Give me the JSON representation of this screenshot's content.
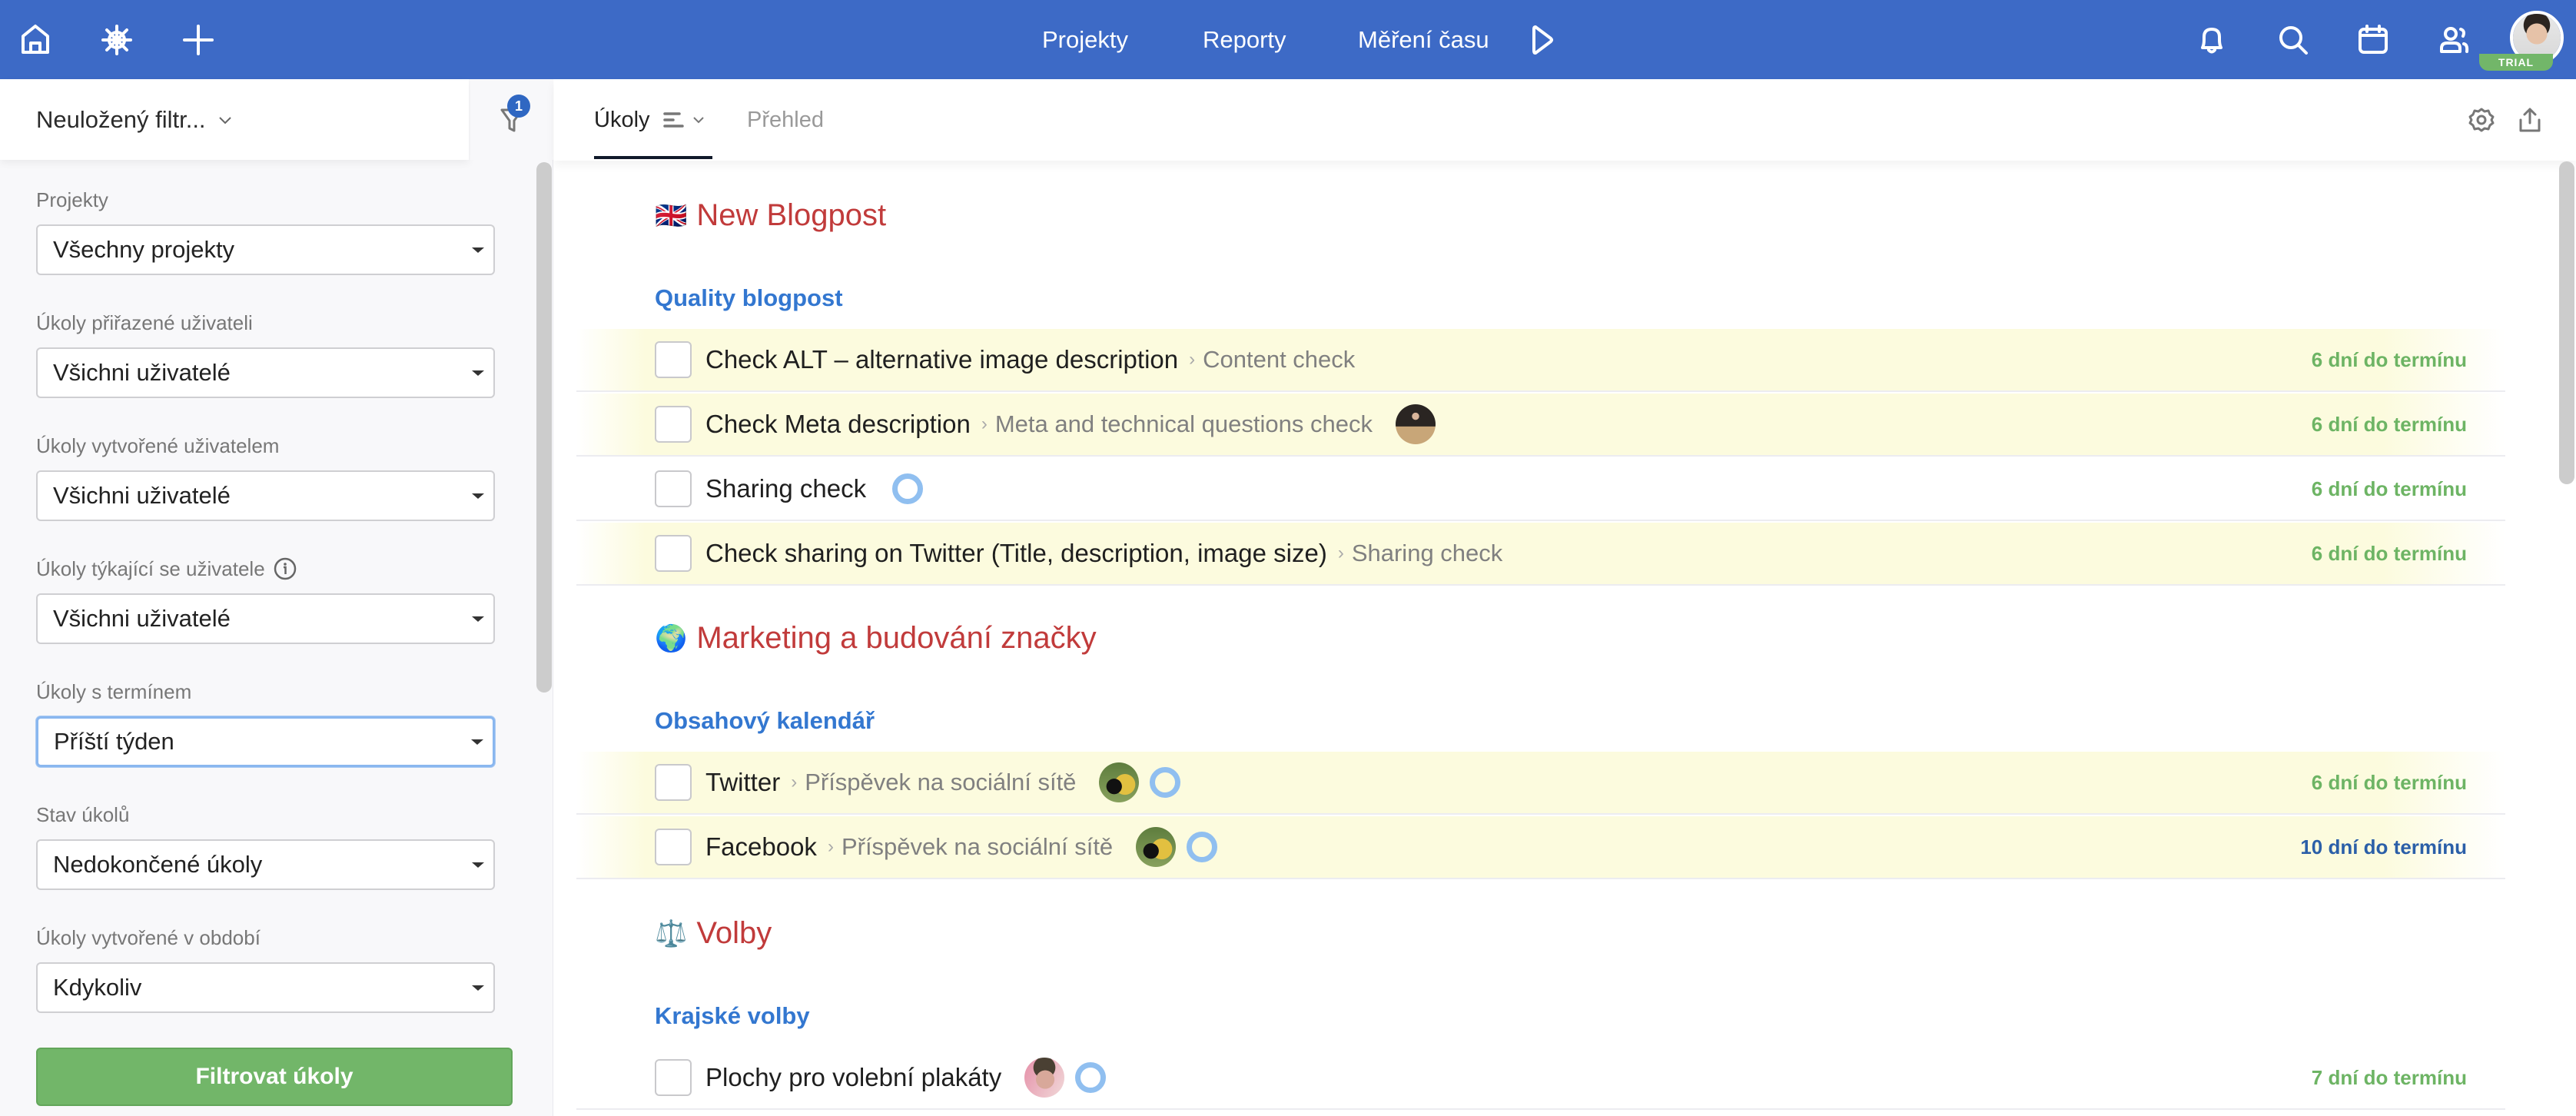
{
  "colors": {
    "topbar": "#3d6ac6",
    "accent_green": "#72b669",
    "project_title": "#c13b3b",
    "section_title": "#3377d0",
    "due_soon": "#6db464",
    "due_later": "#2b5fa8",
    "row_highlight": "#fcfbde"
  },
  "topbar": {
    "left_icons": [
      "home-icon",
      "helm-icon",
      "plus-icon"
    ],
    "nav": [
      {
        "label": "Projekty"
      },
      {
        "label": "Reporty"
      },
      {
        "label": "Měření času"
      }
    ],
    "right_icons": [
      "bell-icon",
      "search-icon",
      "calendar-icon",
      "users-icon"
    ],
    "user_badge": "TRIAL"
  },
  "sidebar": {
    "filter_name": "Neuložený filtr...",
    "filter_count": "1",
    "fields": [
      {
        "label": "Projekty",
        "value": "Všechny projekty"
      },
      {
        "label": "Úkoly přiřazené uživateli",
        "value": "Všichni uživatelé"
      },
      {
        "label": "Úkoly vytvořené uživatelem",
        "value": "Všichni uživatelé"
      },
      {
        "label": "Úkoly týkající se uživatele",
        "value": "Všichni uživatelé",
        "has_info": true
      },
      {
        "label": "Úkoly s termínem",
        "value": "Příští týden",
        "focused": true
      },
      {
        "label": "Stav úkolů",
        "value": "Nedokončené úkoly"
      },
      {
        "label": "Úkoly vytvořené v období",
        "value": "Kdykoliv"
      }
    ],
    "submit_label": "Filtrovat úkoly"
  },
  "main": {
    "tabs": [
      {
        "label": "Úkoly",
        "active": true
      },
      {
        "label": "Přehled",
        "active": false
      }
    ],
    "projects": [
      {
        "emoji": "🇬🇧",
        "title": "New Blogpost",
        "sections": [
          {
            "title": "Quality blogpost",
            "tasks": [
              {
                "name": "Check ALT – alternative image description",
                "parent": "Content check",
                "due": "6 dní do termínu",
                "due_color": "green",
                "highlight": true
              },
              {
                "name": "Check Meta description",
                "parent": "Meta and technical questions check",
                "avatar": "presenter",
                "due": "6 dní do termínu",
                "due_color": "green",
                "highlight": true
              },
              {
                "name": "Sharing check",
                "progress": true,
                "due": "6 dní do termínu",
                "due_color": "green",
                "highlight": false
              },
              {
                "name": "Check sharing on Twitter (Title, description, image size)",
                "parent": "Sharing check",
                "due": "6 dní do termínu",
                "due_color": "green",
                "highlight": true
              }
            ]
          }
        ]
      },
      {
        "emoji": "🌍",
        "title": "Marketing a budování značky",
        "sections": [
          {
            "title": "Obsahový kalendář",
            "tasks": [
              {
                "name": "Twitter",
                "parent": "Příspěvek na sociální sítě",
                "avatar": "dog",
                "progress": true,
                "due": "6 dní do termínu",
                "due_color": "green",
                "highlight": true
              },
              {
                "name": "Facebook",
                "parent": "Příspěvek na sociální sítě",
                "avatar": "dog",
                "progress": true,
                "due": "10 dní do termínu",
                "due_color": "blue",
                "highlight": true
              }
            ]
          }
        ]
      },
      {
        "emoji": "⚖️",
        "title": "Volby",
        "sections": [
          {
            "title": "Krajské volby",
            "tasks": [
              {
                "name": "Plochy pro volební plakáty",
                "avatar": "man",
                "progress": true,
                "due": "7 dní do termínu",
                "due_color": "green",
                "highlight": false
              }
            ]
          }
        ]
      }
    ]
  }
}
